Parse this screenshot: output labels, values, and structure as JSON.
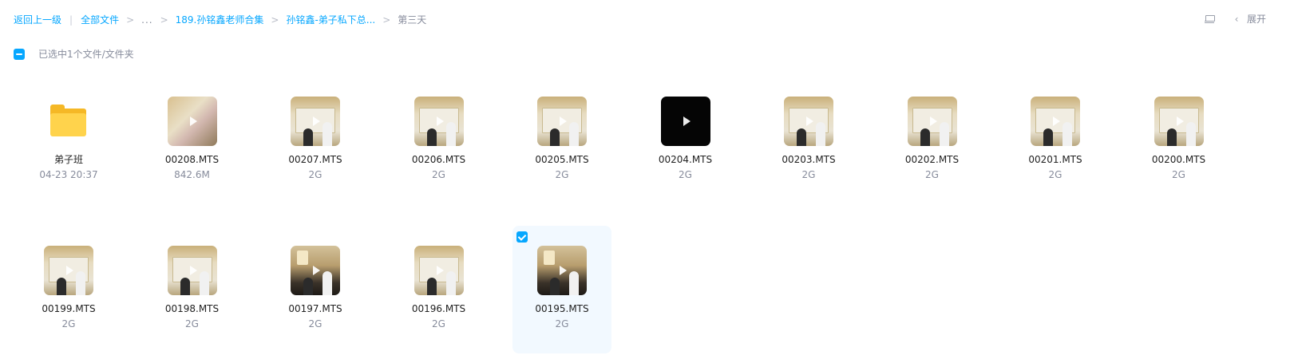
{
  "breadcrumb": {
    "back": "返回上一级",
    "bar": "|",
    "all_files": "全部文件",
    "sep": ">",
    "ellipsis": "...",
    "level1": "189.孙铭鑫老师合集",
    "level2": "孙铭鑫-弟子私下总...",
    "current": "第三天"
  },
  "toolbar": {
    "list_view_icon": "list-view-icon",
    "expand_chevron": "‹",
    "expand_label": "展开"
  },
  "selection": {
    "label": "已选中1个文件/文件夹"
  },
  "colors": {
    "accent": "#06a7ff",
    "muted_text": "#878c9c",
    "folder": "#ffd34c",
    "selected_bg": "#f2f9ff"
  },
  "items": [
    {
      "type": "folder",
      "name": "弟子班",
      "meta": "04-23 20:37",
      "selected": false
    },
    {
      "type": "video",
      "name": "00208.MTS",
      "meta": "842.6M",
      "selected": false,
      "thumb": "paint"
    },
    {
      "type": "video",
      "name": "00207.MTS",
      "meta": "2G",
      "selected": false,
      "thumb": "wall"
    },
    {
      "type": "video",
      "name": "00206.MTS",
      "meta": "2G",
      "selected": false,
      "thumb": "wall"
    },
    {
      "type": "video",
      "name": "00205.MTS",
      "meta": "2G",
      "selected": false,
      "thumb": "wall"
    },
    {
      "type": "video",
      "name": "00204.MTS",
      "meta": "2G",
      "selected": false,
      "thumb": "dark"
    },
    {
      "type": "video",
      "name": "00203.MTS",
      "meta": "2G",
      "selected": false,
      "thumb": "wall"
    },
    {
      "type": "video",
      "name": "00202.MTS",
      "meta": "2G",
      "selected": false,
      "thumb": "wall"
    },
    {
      "type": "video",
      "name": "00201.MTS",
      "meta": "2G",
      "selected": false,
      "thumb": "wall"
    },
    {
      "type": "video",
      "name": "00200.MTS",
      "meta": "2G",
      "selected": false,
      "thumb": "wall"
    },
    {
      "type": "video",
      "name": "00199.MTS",
      "meta": "2G",
      "selected": false,
      "thumb": "wall"
    },
    {
      "type": "video",
      "name": "00198.MTS",
      "meta": "2G",
      "selected": false,
      "thumb": "wall"
    },
    {
      "type": "video",
      "name": "00197.MTS",
      "meta": "2G",
      "selected": false,
      "thumb": "room"
    },
    {
      "type": "video",
      "name": "00196.MTS",
      "meta": "2G",
      "selected": false,
      "thumb": "wall"
    },
    {
      "type": "video",
      "name": "00195.MTS",
      "meta": "2G",
      "selected": true,
      "thumb": "room"
    }
  ]
}
